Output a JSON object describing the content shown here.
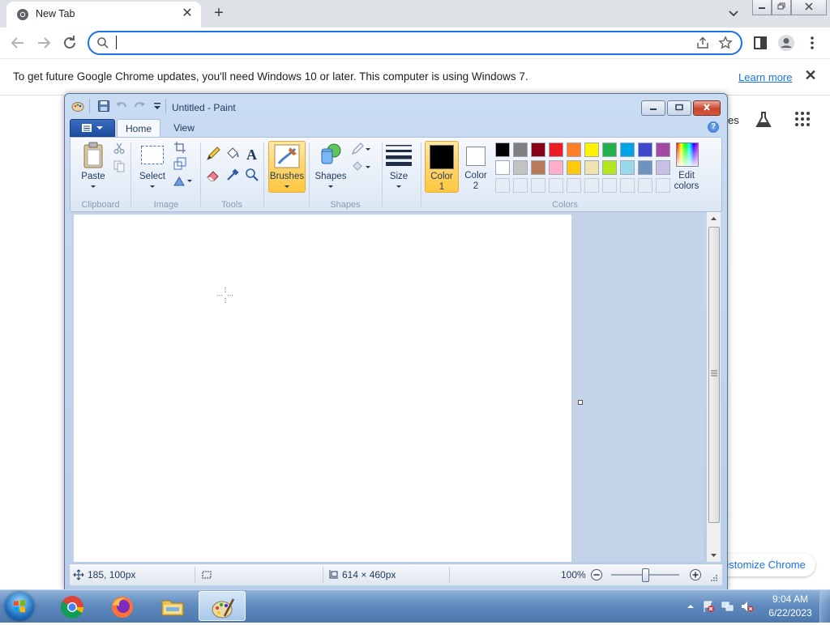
{
  "chrome": {
    "tab_title": "New Tab",
    "omnibox_value": "",
    "infobar_text": "To get future Google Chrome updates, you'll need Windows 10 or later. This computer is using Windows 7.",
    "infobar_link": "Learn more",
    "ntp_fragment": "es",
    "customize_label": "ustomize Chrome",
    "accent_color": "#1a73e8"
  },
  "paint": {
    "title": "Untitled - Paint",
    "tabs": {
      "home": "Home",
      "view": "View"
    },
    "help": "?",
    "ribbon": {
      "paste": "Paste",
      "select": "Select",
      "brushes": "Brushes",
      "shapes": "Shapes",
      "size": "Size",
      "color1_line1": "Color",
      "color1_line2": "1",
      "color2_line1": "Color",
      "color2_line2": "2",
      "edit_colors_line1": "Edit",
      "edit_colors_line2": "colors",
      "groups": {
        "clipboard": "Clipboard",
        "image": "Image",
        "tools": "Tools",
        "shapes": "Shapes",
        "colors": "Colors"
      }
    },
    "palette": {
      "row1": [
        "#000000",
        "#7f7f7f",
        "#880015",
        "#ed1c24",
        "#ff7f27",
        "#fff200",
        "#22b14c",
        "#00a2e8",
        "#3f48cc",
        "#a349a4"
      ],
      "row2": [
        "#ffffff",
        "#c3c3c3",
        "#b97a57",
        "#ffaec9",
        "#ffc90e",
        "#efe4b0",
        "#b5e61d",
        "#99d9ea",
        "#7092be",
        "#c8bfe7"
      ]
    },
    "color1": "#000000",
    "color2": "#ffffff",
    "status": {
      "cursor_position": "185, 100px",
      "image_size": "614 × 460px",
      "zoom": "100%"
    }
  },
  "taskbar": {
    "time": "9:04 AM",
    "date": "6/22/2023"
  }
}
